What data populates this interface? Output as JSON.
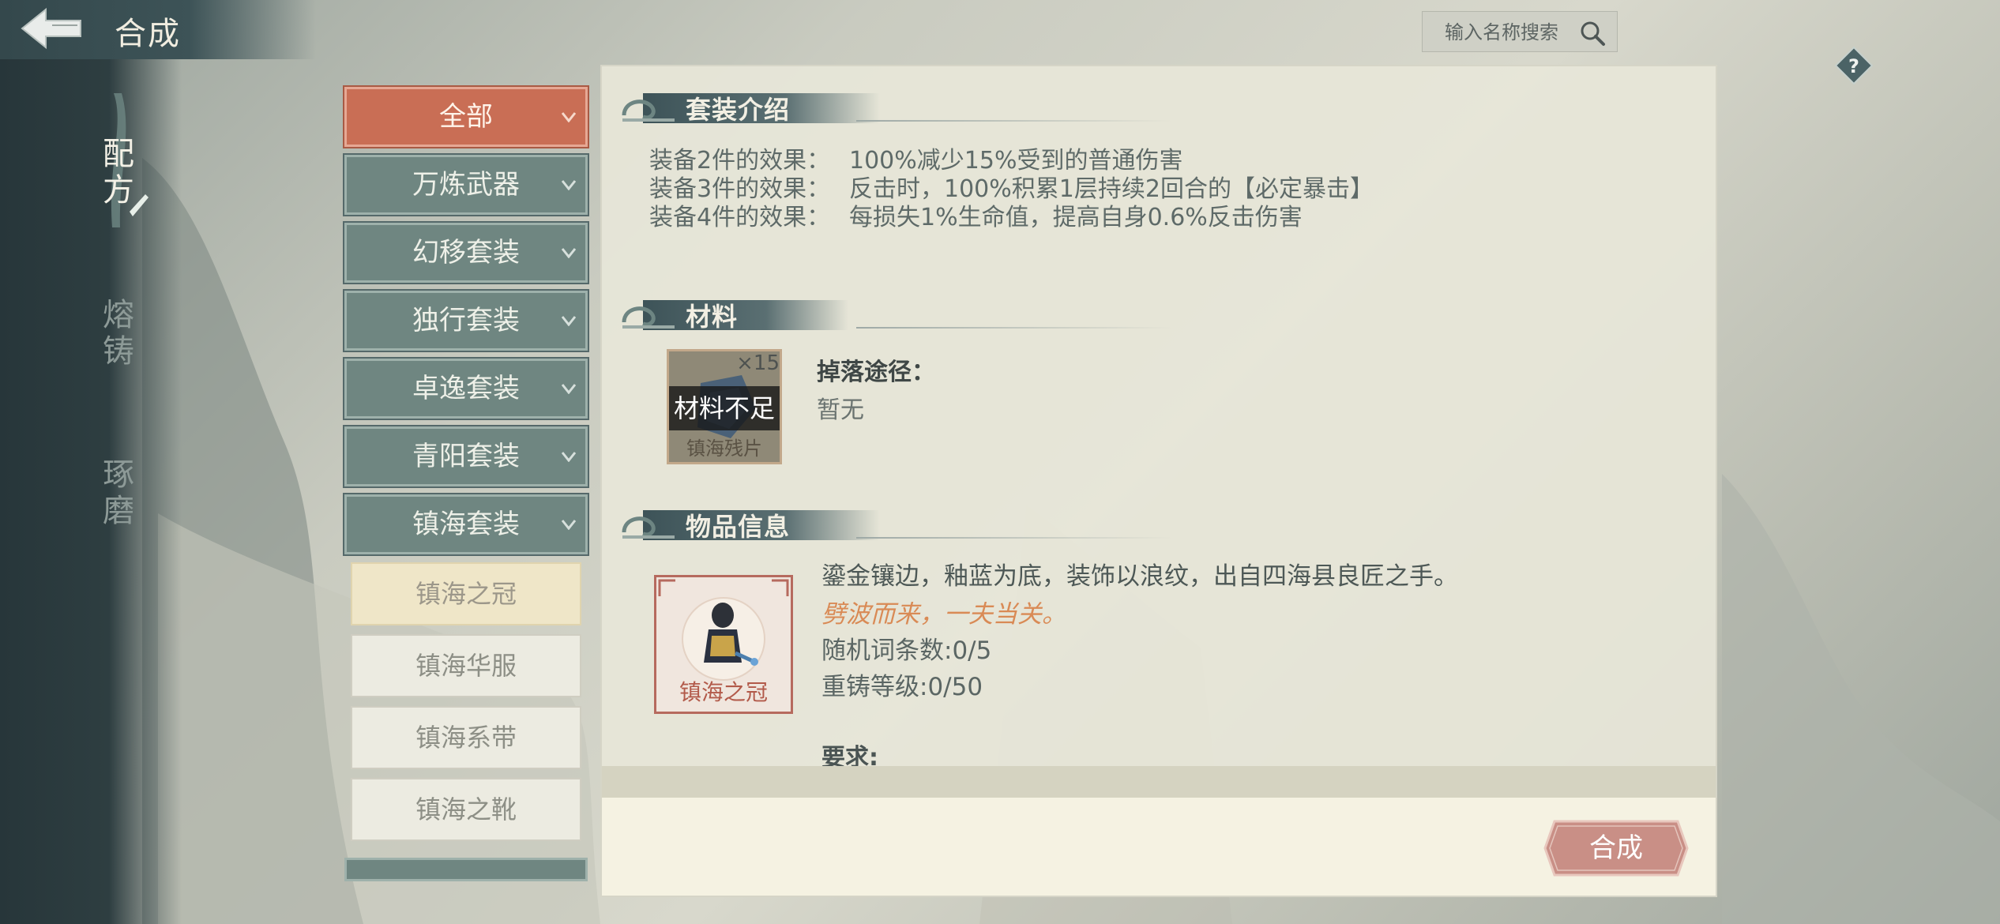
{
  "header": {
    "title": "合成",
    "search_placeholder": "输入名称搜索"
  },
  "side_tabs": [
    {
      "label": "配方",
      "active": true
    },
    {
      "label": "熔铸",
      "active": false
    },
    {
      "label": "琢磨",
      "active": false
    }
  ],
  "categories": [
    {
      "label": "全部",
      "active": true
    },
    {
      "label": "万炼武器",
      "active": false
    },
    {
      "label": "幻移套装",
      "active": false
    },
    {
      "label": "独行套装",
      "active": false
    },
    {
      "label": "卓逸套装",
      "active": false
    },
    {
      "label": "青阳套装",
      "active": false
    },
    {
      "label": "镇海套装",
      "active": false,
      "expanded": true
    }
  ],
  "sub_items": [
    {
      "label": "镇海之冠",
      "selected": true
    },
    {
      "label": "镇海华服",
      "selected": false
    },
    {
      "label": "镇海系带",
      "selected": false
    },
    {
      "label": "镇海之靴",
      "selected": false
    }
  ],
  "set_intro": {
    "title": "套装介绍",
    "effects": [
      {
        "label": "装备2件的效果：",
        "text": "100%减少15%受到的普通伤害"
      },
      {
        "label": "装备3件的效果：",
        "text": "反击时，100%积累1层持续2回合的【必定暴击】"
      },
      {
        "label": "装备4件的效果：",
        "text": "每损失1%生命值，提高自身0.6%反击伤害"
      }
    ]
  },
  "materials": {
    "title": "材料",
    "item_name": "镇海残片",
    "count": "×15",
    "overlay": "材料不足",
    "drop_label": "掉落途径：",
    "drop_value": "暂无"
  },
  "item_info": {
    "title": "物品信息",
    "item_name": "镇海之冠",
    "description": "鎏金镶边，釉蓝为底，装饰以浪纹，出自四海县良匠之手。",
    "flavor": "劈波而来，一夫当关。",
    "random_affixes": "随机词条数:0/5",
    "reforge_level": "重铸等级:0/50",
    "requirements_label": "要求:"
  },
  "actions": {
    "craft": "合成"
  },
  "colors": {
    "active_category": "#c96e55",
    "category": "#6f8681",
    "item_border": "#b66a5e",
    "flavor_text": "#d98a55",
    "craft_button": "#c98f86"
  }
}
